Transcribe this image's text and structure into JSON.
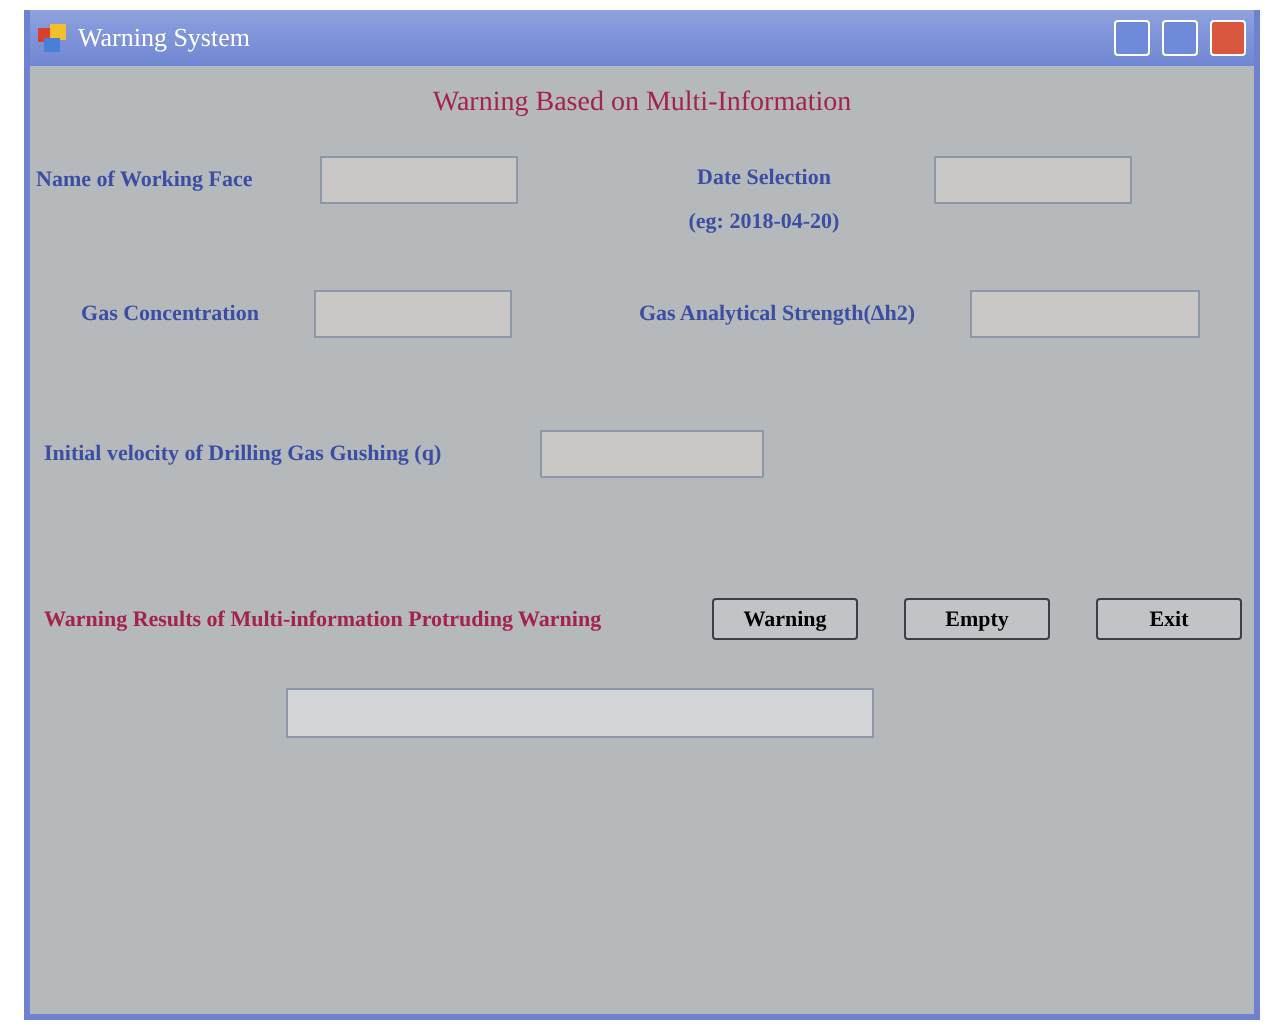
{
  "window": {
    "title": "Warning System"
  },
  "heading": "Warning Based on Multi-Information",
  "fields": [
    {
      "label": "Name of Working Face"
    },
    {
      "label": "Date Selection",
      "hint": "(eg: 2018-04-20)"
    },
    {
      "label": "Gas Concentration"
    },
    {
      "label": "Gas Analytical Strength(Δh2)"
    },
    {
      "label": "Initial velocity of Drilling Gas Gushing (q)"
    }
  ],
  "results_label": "Warning Results of Multi-information Protruding Warning",
  "buttons": [
    "Warning",
    "Empty",
    "Exit"
  ]
}
